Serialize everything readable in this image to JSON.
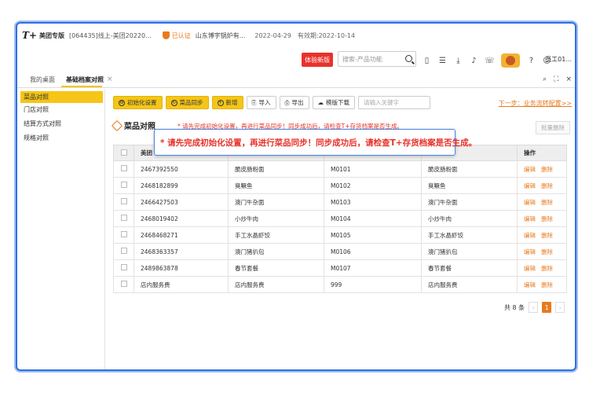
{
  "header": {
    "logo_brand": "T+",
    "logo_edition": "美团专版",
    "account": "[064435]线上-美团20220...",
    "certified": "已认证",
    "company": "山东博宇锅炉有...",
    "date": "2022-04-29",
    "valid_until": "有效期:2022-10-14"
  },
  "toolbar": {
    "trial_label": "体验新版",
    "search_placeholder": "搜索-产品功能",
    "user_label": "员工01..."
  },
  "tabs": [
    {
      "label": "我的桌面"
    },
    {
      "label": "基础档案对照"
    }
  ],
  "sidebar": {
    "items": [
      {
        "label": "菜品对照"
      },
      {
        "label": "门店对照"
      },
      {
        "label": "结算方式对照"
      },
      {
        "label": "规格对照"
      }
    ]
  },
  "actions": {
    "init_label": "初始化设置",
    "sync_label": "菜品同步",
    "add_label": "新增",
    "import_label": "导入",
    "export_label": "导出",
    "template_label": "模版下载",
    "keyword_placeholder": "请输入关键字",
    "next_step": "下一步：业务流转配置>>"
  },
  "section": {
    "title": "菜品对照",
    "hint": "* 请先完成初始化设置，再进行菜品同步！同步成功后，请检查T+存货档案是否生成。",
    "tooltip": "* 请先完成初始化设置，再进行菜品同步！同步成功后，请检查T+存货档案是否生成。",
    "batch_delete": "批量删除"
  },
  "table": {
    "headers": [
      "美团",
      "",
      "",
      "",
      "操作"
    ],
    "rows": [
      [
        "2467392550",
        "脆皮肠粉面",
        "M0101",
        "脆皮肠粉面"
      ],
      [
        "2468182899",
        "臭鳜鱼",
        "M0102",
        "臭鳜鱼"
      ],
      [
        "2466427503",
        "澳门牛杂面",
        "M0103",
        "澳门牛杂面"
      ],
      [
        "2468019402",
        "小炒牛肉",
        "M0104",
        "小炒牛肉"
      ],
      [
        "2468468271",
        "手工水晶虾饺",
        "M0105",
        "手工水晶虾饺"
      ],
      [
        "2468363357",
        "澳门猪扒包",
        "M0106",
        "澳门猪扒包"
      ],
      [
        "2489863878",
        "春节套餐",
        "M0107",
        "春节套餐"
      ],
      [
        "店内服务费",
        "店内服务费",
        "999",
        "店内服务费"
      ]
    ],
    "edit_label": "编辑",
    "delete_label": "删除"
  },
  "pager": {
    "total": "共 8 条",
    "prev": "‹",
    "current": "1",
    "next": "›"
  },
  "colors": {
    "accent_yellow": "#f5c518",
    "link_orange": "#e87a1e",
    "alert_red": "#e8322a",
    "frame_blue": "#2f6fe0"
  }
}
